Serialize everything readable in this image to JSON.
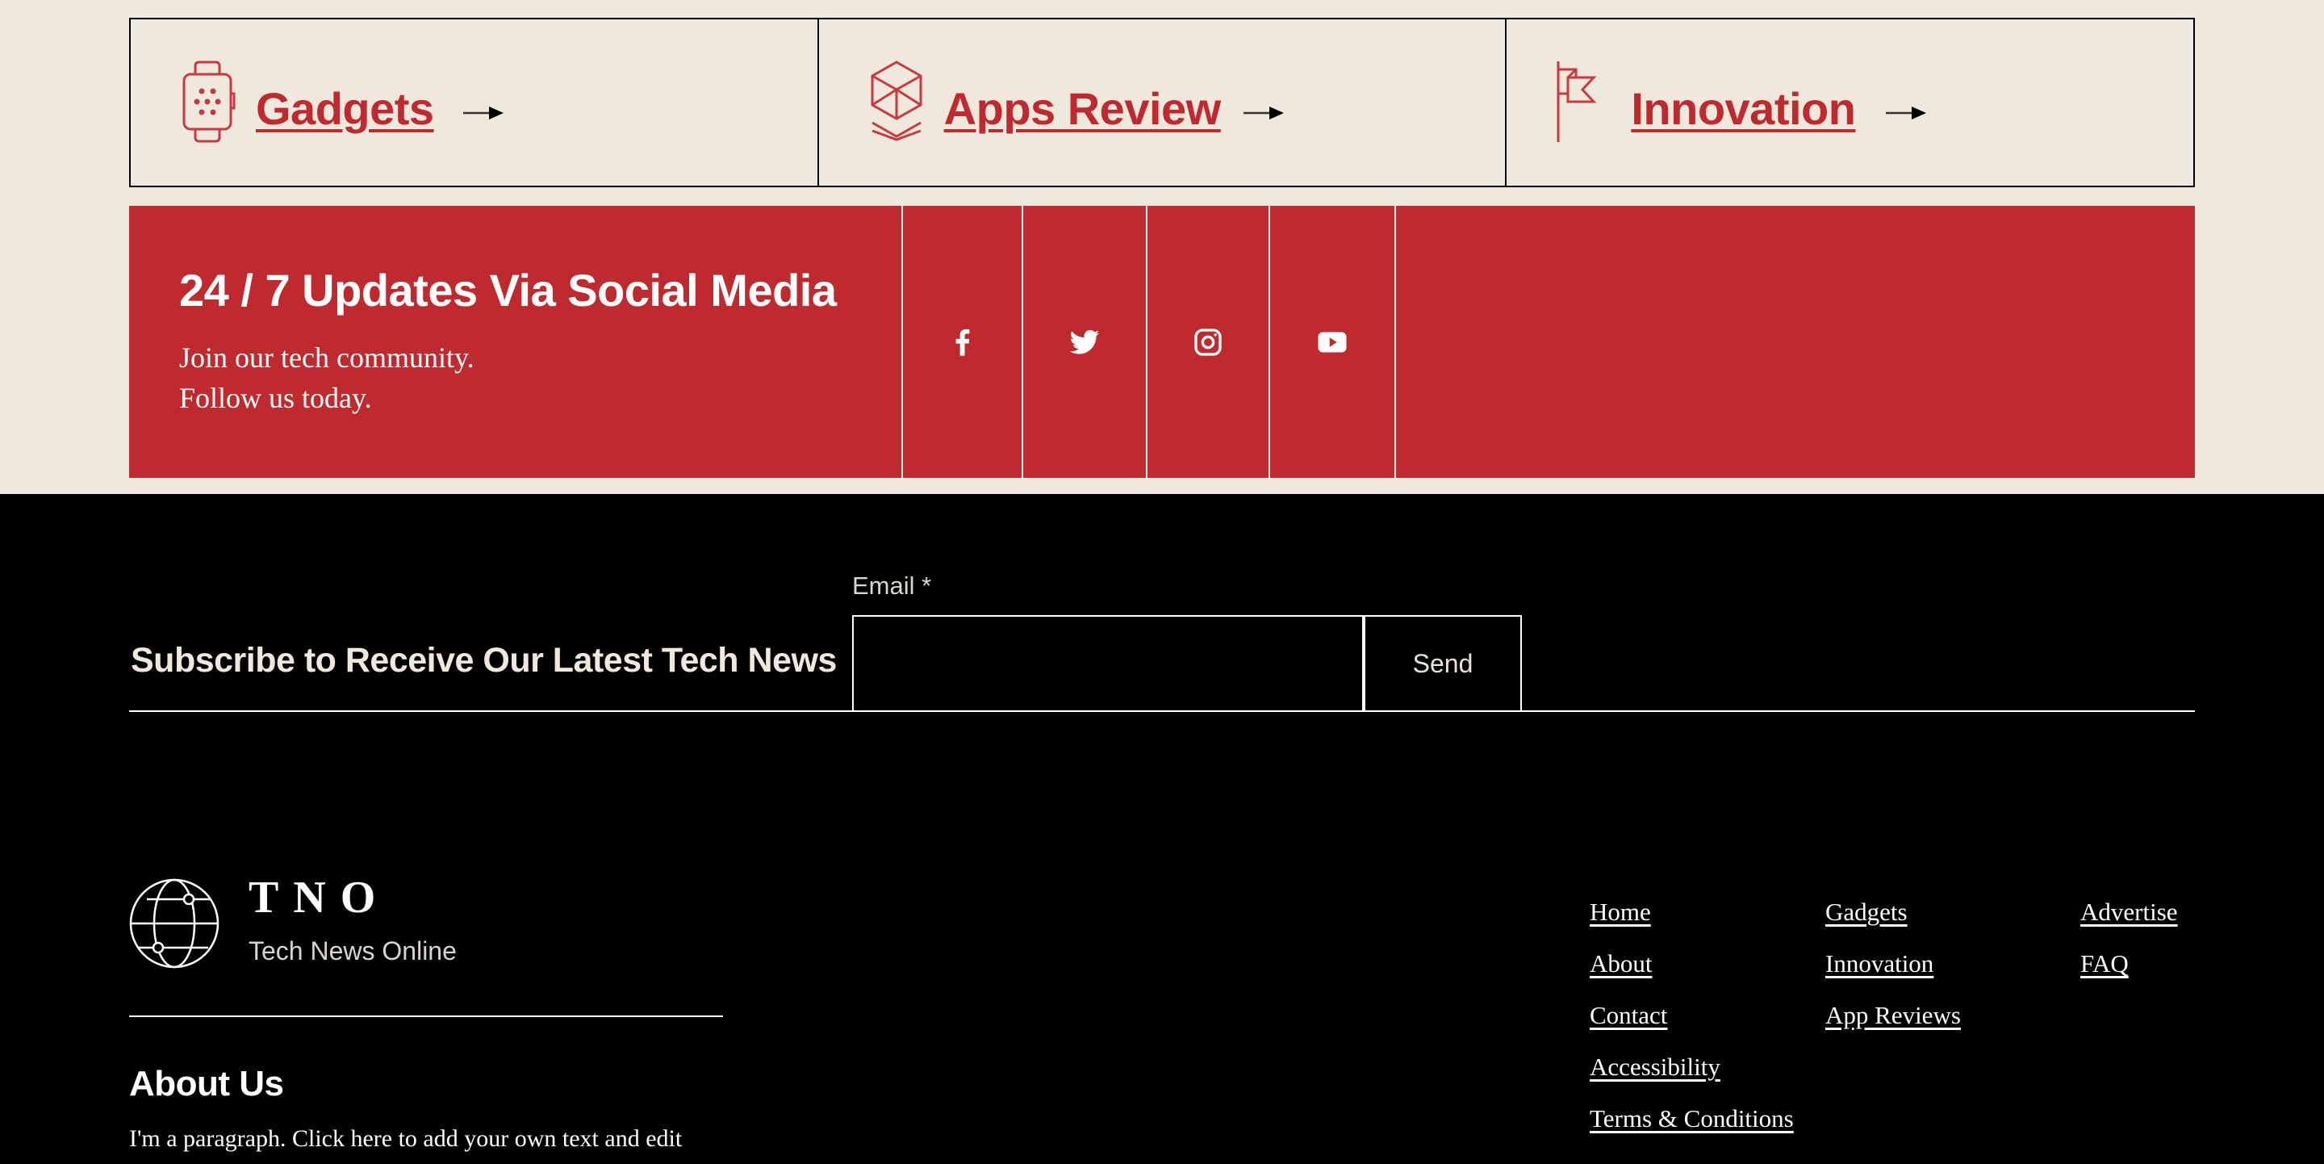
{
  "categories": [
    {
      "label": "Gadgets",
      "icon": "smartwatch-icon"
    },
    {
      "label": "Apps Review",
      "icon": "cube-stack-icon"
    },
    {
      "label": "Innovation",
      "icon": "flag-icon"
    }
  ],
  "social_banner": {
    "title": "24 / 7 Updates Via Social Media",
    "line1": "Join our tech community.",
    "line2": "Follow us today.",
    "links": [
      {
        "name": "Facebook",
        "icon": "facebook-icon"
      },
      {
        "name": "Twitter",
        "icon": "twitter-icon"
      },
      {
        "name": "Instagram",
        "icon": "instagram-icon"
      },
      {
        "name": "YouTube",
        "icon": "youtube-icon"
      }
    ]
  },
  "subscribe": {
    "heading": "Subscribe to Receive Our Latest Tech News",
    "email_label": "Email *",
    "email_value": "",
    "send_label": "Send"
  },
  "brand": {
    "name": "TNO",
    "tagline": "Tech News Online"
  },
  "about": {
    "heading": "About Us",
    "text": "I'm a paragraph. Click here to add your own text and edit"
  },
  "footer_links": [
    [
      "Home",
      "About",
      "Contact",
      "Accessibility",
      "Terms & Conditions"
    ],
    [
      "Gadgets",
      "Innovation",
      "App Reviews"
    ],
    [
      "Advertise",
      "FAQ"
    ]
  ],
  "colors": {
    "background": "#EFE8DC",
    "accent_red": "#BE2A2E",
    "footer_bg": "#000000",
    "text_light": "#FFFFFF"
  }
}
